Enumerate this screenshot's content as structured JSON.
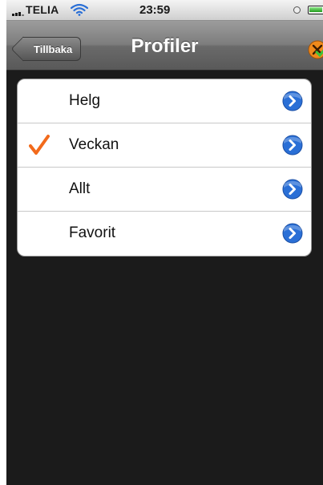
{
  "status_bar": {
    "carrier": "TELIA",
    "time": "23:59"
  },
  "nav_bar": {
    "back_label": "Tillbaka",
    "title": "Profiler"
  },
  "profiles": [
    {
      "label": "Helg",
      "selected": false
    },
    {
      "label": "Veckan",
      "selected": true
    },
    {
      "label": "Allt",
      "selected": false
    },
    {
      "label": "Favorit",
      "selected": false
    }
  ],
  "colors": {
    "checkmark": "#f26a1b",
    "disclosure": "#2a6fd6"
  },
  "icons": {
    "selected": "checkmark-icon",
    "row_action": "disclosure-arrow-icon",
    "nav_right": "app-badge-icon"
  }
}
